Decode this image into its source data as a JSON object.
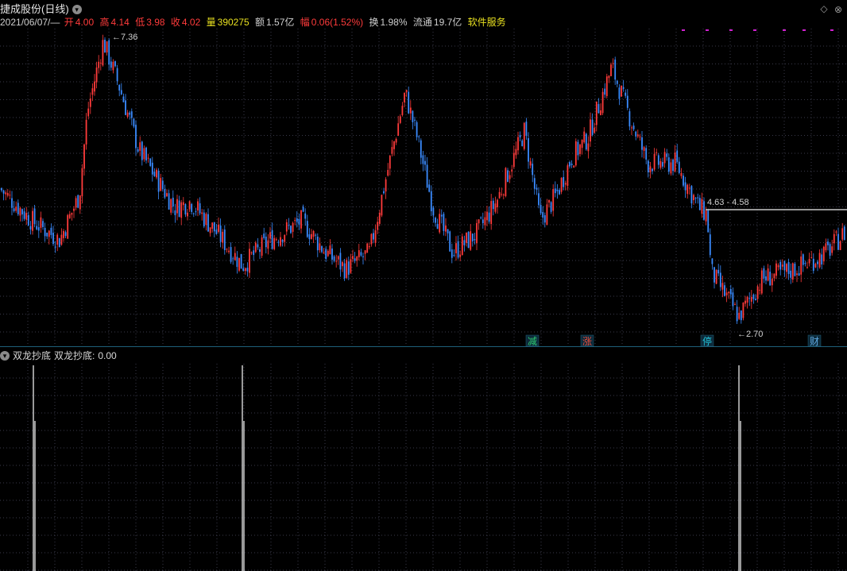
{
  "header": {
    "title": "捷成股份(日线)",
    "date": "2021/06/07/—",
    "open_label": "开",
    "open": "4.00",
    "high_label": "高",
    "high": "4.14",
    "low_label": "低",
    "low": "3.98",
    "close_label": "收",
    "close": "4.02",
    "volume_label": "量",
    "volume": "390275",
    "amount_label": "额",
    "amount": "1.57亿",
    "change_label": "幅",
    "change": "0.06(1.52%)",
    "turnover_label": "换",
    "turnover": "1.98%",
    "float_label": "流通",
    "float": "19.7亿",
    "sector": "软件服务"
  },
  "annotations": {
    "high_marker": "7.36",
    "low_marker": "2.70",
    "price_range": "4.63 - 4.58"
  },
  "event_badges": [
    {
      "label": "减",
      "color": "#2ecc71"
    },
    {
      "label": "涨",
      "color": "#e74c3c"
    },
    {
      "label": "停",
      "color": "#22c1d8"
    },
    {
      "label": "财",
      "color": "#5fa8e0"
    }
  ],
  "indicator": {
    "name": "双龙抄底",
    "value_label": "双龙抄底:",
    "value": "0.00"
  },
  "colors": {
    "up": "#ff3b3b",
    "down": "#3a8bff",
    "grid": "#3a3a4a",
    "separator": "#1f5f7a",
    "signal": "#ffffff"
  },
  "chart_data": {
    "type": "candlestick",
    "title": "捷成股份(日线)",
    "ylim": [
      2.6,
      7.5
    ],
    "key_prices": {
      "high": 7.36,
      "low": 2.7,
      "gap_top": 4.63,
      "gap_bottom": 4.58
    },
    "close_path": [
      [
        0,
        5.0
      ],
      [
        40,
        4.5
      ],
      [
        75,
        4.2
      ],
      [
        100,
        4.9
      ],
      [
        110,
        6.2
      ],
      [
        130,
        7.3
      ],
      [
        150,
        6.6
      ],
      [
        175,
        5.6
      ],
      [
        220,
        4.7
      ],
      [
        240,
        4.8
      ],
      [
        280,
        4.2
      ],
      [
        305,
        3.8
      ],
      [
        340,
        4.2
      ],
      [
        380,
        4.5
      ],
      [
        410,
        4.0
      ],
      [
        435,
        3.75
      ],
      [
        465,
        4.0
      ],
      [
        490,
        5.4
      ],
      [
        510,
        6.5
      ],
      [
        525,
        5.8
      ],
      [
        545,
        4.7
      ],
      [
        570,
        4.0
      ],
      [
        600,
        4.3
      ],
      [
        625,
        4.8
      ],
      [
        660,
        5.9
      ],
      [
        680,
        4.5
      ],
      [
        700,
        4.9
      ],
      [
        720,
        5.5
      ],
      [
        740,
        5.8
      ],
      [
        770,
        6.9
      ],
      [
        790,
        6.2
      ],
      [
        815,
        5.4
      ],
      [
        850,
        5.4
      ],
      [
        880,
        4.7
      ],
      [
        890,
        4.6
      ],
      [
        895,
        3.7
      ],
      [
        930,
        3.0
      ],
      [
        960,
        3.6
      ],
      [
        990,
        3.7
      ],
      [
        1010,
        3.8
      ],
      [
        1040,
        4.0
      ],
      [
        1062,
        4.3
      ]
    ],
    "signals": [
      {
        "x": 42,
        "value": 1
      },
      {
        "x": 305,
        "value": 1
      },
      {
        "x": 930,
        "value": 1
      }
    ]
  }
}
